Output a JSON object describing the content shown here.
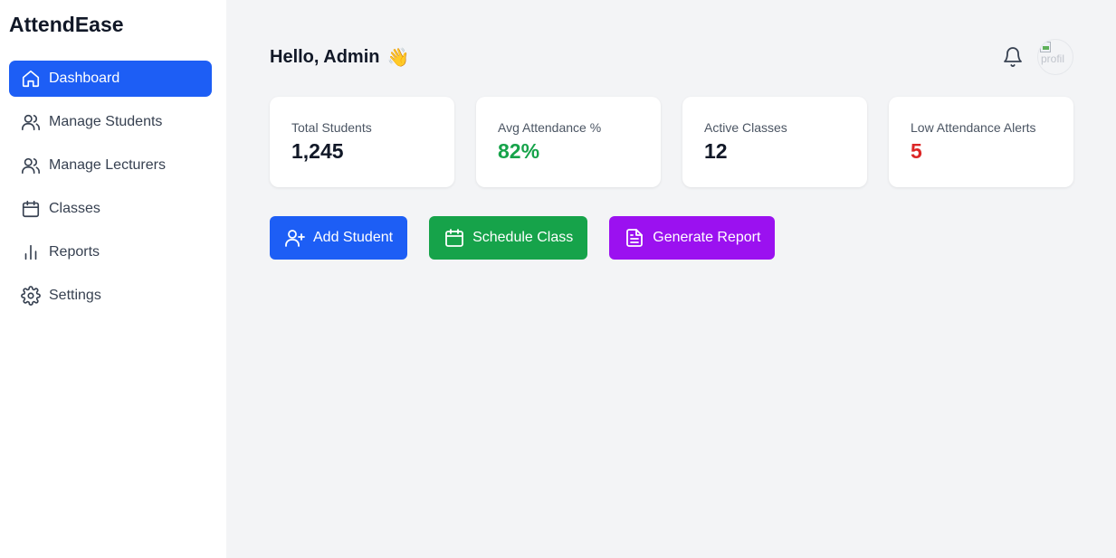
{
  "app": {
    "title": "AttendEase"
  },
  "sidebar": {
    "items": [
      {
        "label": "Dashboard",
        "icon": "home-icon",
        "active": true
      },
      {
        "label": "Manage Students",
        "icon": "users-icon"
      },
      {
        "label": "Manage Lecturers",
        "icon": "users-icon"
      },
      {
        "label": "Classes",
        "icon": "calendar-icon"
      },
      {
        "label": "Reports",
        "icon": "bar-chart-icon"
      },
      {
        "label": "Settings",
        "icon": "gear-icon"
      }
    ]
  },
  "header": {
    "greeting": "Hello, Admin",
    "wave": "👋",
    "avatar_alt": "profil"
  },
  "stats": [
    {
      "label": "Total Students",
      "value": "1,245",
      "color": "#111827"
    },
    {
      "label": "Avg Attendance %",
      "value": "82%",
      "color": "#16a34a"
    },
    {
      "label": "Active Classes",
      "value": "12",
      "color": "#111827"
    },
    {
      "label": "Low Attendance Alerts",
      "value": "5",
      "color": "#dc2626"
    }
  ],
  "actions": [
    {
      "label": "Add Student",
      "icon": "user-plus-icon",
      "color": "#1d5ef5"
    },
    {
      "label": "Schedule Class",
      "icon": "calendar-icon",
      "color": "#16a34a"
    },
    {
      "label": "Generate Report",
      "icon": "file-text-icon",
      "color": "#9b11f0"
    }
  ]
}
